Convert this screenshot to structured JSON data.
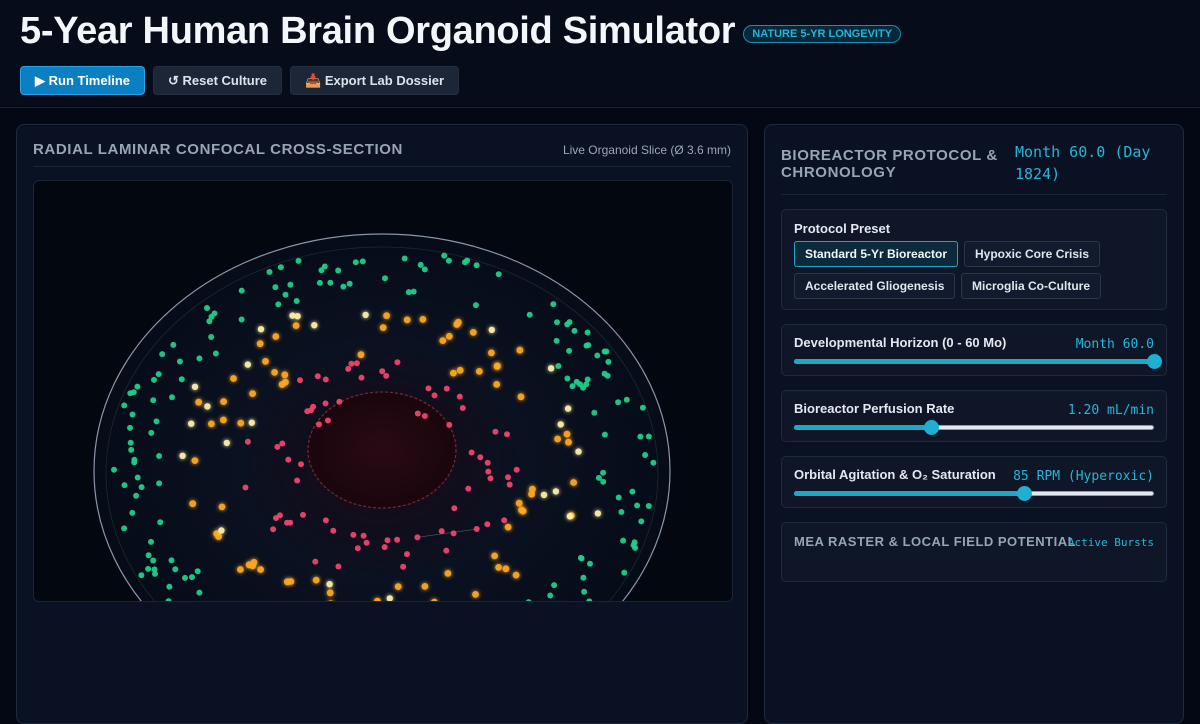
{
  "header": {
    "title": "5-Year Human Brain Organoid Simulator",
    "badge": "NATURE 5-YR LONGEVITY",
    "buttons": {
      "run": "▶ Run Timeline",
      "reset": "↺ Reset Culture",
      "export": "📥 Export Lab Dossier"
    }
  },
  "left_panel": {
    "title": "RADIAL LAMINAR CONFOCAL CROSS-SECTION",
    "subtitle": "Live Organoid Slice (Ø 3.6 mm)"
  },
  "right_panel": {
    "title": "BIOREACTOR PROTOCOL & CHRONOLOGY",
    "month_readout": "Month 60.0 (Day 1824)",
    "preset": {
      "label": "Protocol Preset",
      "options": [
        "Standard 5-Yr Bioreactor",
        "Hypoxic Core Crisis",
        "Accelerated Gliogenesis",
        "Microglia Co-Culture"
      ],
      "selected": "Standard 5-Yr Bioreactor"
    },
    "sliders": [
      {
        "label": "Developmental Horizon (0 - 60 Mo)",
        "value_text": "Month 60.0",
        "fraction": 1.0
      },
      {
        "label": "Bioreactor Perfusion Rate",
        "value_text": "1.20 mL/min",
        "fraction": 0.38
      },
      {
        "label": "Orbital Agitation & O₂ Saturation",
        "value_text": "85 RPM (Hyperoxic)",
        "fraction": 0.64
      }
    ],
    "mea": {
      "label": "MEA RASTER & LOCAL FIELD POTENTIAL",
      "status": "Active Bursts"
    }
  },
  "colors": {
    "accent": "#22b7d9",
    "primary_button": "#0b7fc1",
    "progenitor_cells": "#1fcf8a",
    "migrating_neurons": "#ffaa22",
    "mature_neurons": "#fff2a8",
    "core_cells": "#f0456e",
    "necrotic_core": "#2a0a14"
  }
}
